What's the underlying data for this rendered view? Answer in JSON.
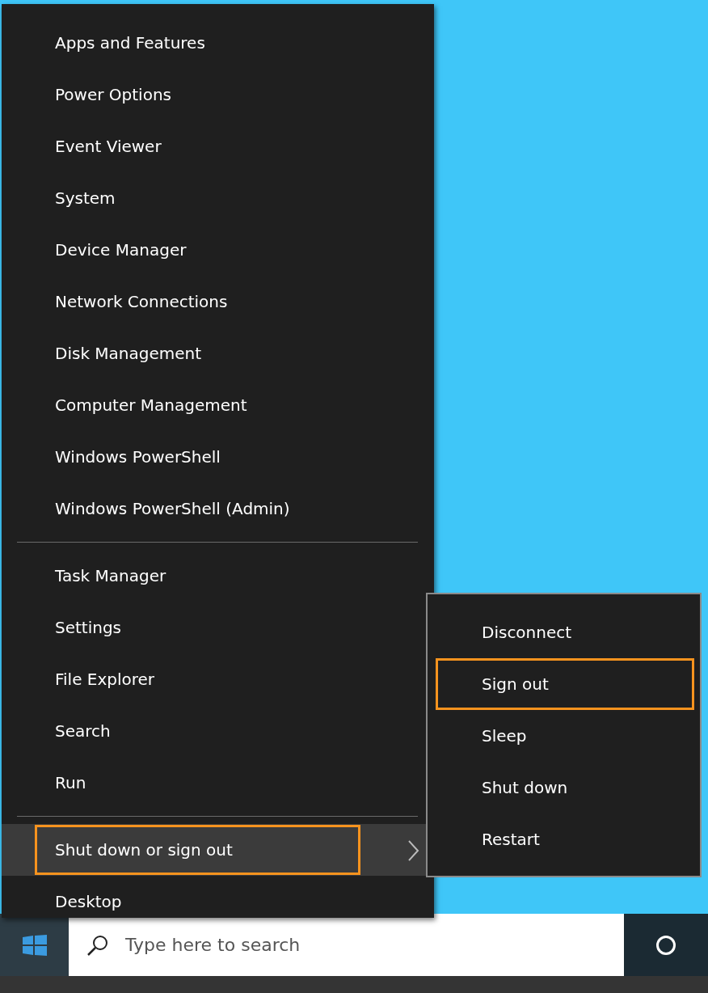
{
  "menu": {
    "groups": [
      {
        "items": [
          {
            "label": "Apps and Features",
            "hovered": false,
            "outlined": false,
            "submenu": false
          },
          {
            "label": "Power Options",
            "hovered": false,
            "outlined": false,
            "submenu": false
          },
          {
            "label": "Event Viewer",
            "hovered": false,
            "outlined": false,
            "submenu": false
          },
          {
            "label": "System",
            "hovered": false,
            "outlined": false,
            "submenu": false
          },
          {
            "label": "Device Manager",
            "hovered": false,
            "outlined": false,
            "submenu": false
          },
          {
            "label": "Network Connections",
            "hovered": false,
            "outlined": false,
            "submenu": false
          },
          {
            "label": "Disk Management",
            "hovered": false,
            "outlined": false,
            "submenu": false
          },
          {
            "label": "Computer Management",
            "hovered": false,
            "outlined": false,
            "submenu": false
          },
          {
            "label": "Windows PowerShell",
            "hovered": false,
            "outlined": false,
            "submenu": false
          },
          {
            "label": "Windows PowerShell (Admin)",
            "hovered": false,
            "outlined": false,
            "submenu": false
          }
        ]
      },
      {
        "items": [
          {
            "label": "Task Manager",
            "hovered": false,
            "outlined": false,
            "submenu": false
          },
          {
            "label": "Settings",
            "hovered": false,
            "outlined": false,
            "submenu": false
          },
          {
            "label": "File Explorer",
            "hovered": false,
            "outlined": false,
            "submenu": false
          },
          {
            "label": "Search",
            "hovered": false,
            "outlined": false,
            "submenu": false
          },
          {
            "label": "Run",
            "hovered": false,
            "outlined": false,
            "submenu": false
          }
        ]
      },
      {
        "items": [
          {
            "label": "Shut down or sign out",
            "hovered": true,
            "outlined": true,
            "submenu": true
          },
          {
            "label": "Desktop",
            "hovered": false,
            "outlined": false,
            "submenu": false
          }
        ]
      }
    ]
  },
  "submenu": {
    "items": [
      {
        "label": "Disconnect",
        "outlined": false
      },
      {
        "label": "Sign out",
        "outlined": true
      },
      {
        "label": "Sleep",
        "outlined": false
      },
      {
        "label": "Shut down",
        "outlined": false
      },
      {
        "label": "Restart",
        "outlined": false
      }
    ]
  },
  "taskbar": {
    "search": {
      "placeholder": "Type here to search"
    }
  }
}
